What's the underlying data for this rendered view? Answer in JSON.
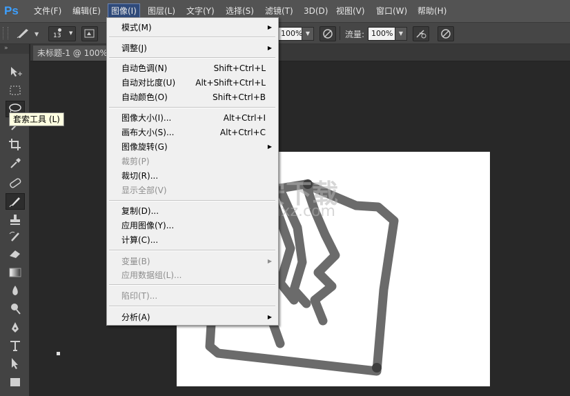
{
  "app": {
    "logo": "Ps"
  },
  "menubar": {
    "items": [
      "文件(F)",
      "编辑(E)",
      "图像(I)",
      "图层(L)",
      "文字(Y)",
      "选择(S)",
      "滤镜(T)",
      "3D(D)",
      "视图(V)",
      "窗口(W)",
      "帮助(H)"
    ],
    "active": "图像(I)"
  },
  "options_bar": {
    "brush_size": "13",
    "opacity_value": "100%",
    "flow_label": "流量:",
    "flow_value": "100%"
  },
  "document": {
    "tab_title": "未标题-1 @ 100%"
  },
  "toolbar": {
    "tooltip": "套索工具 (L)",
    "tools": [
      "move-tool",
      "marquee-tool",
      "lasso-tool",
      "quick-select-tool",
      "crop-tool",
      "eyedropper-tool",
      "healing-brush-tool",
      "brush-tool",
      "clone-stamp-tool",
      "history-brush-tool",
      "eraser-tool",
      "gradient-tool",
      "blur-tool",
      "dodge-tool",
      "pen-tool",
      "type-tool",
      "path-select-tool",
      "shape-tool"
    ]
  },
  "image_menu": {
    "mode": "模式(M)",
    "adjust": "调整(J)",
    "auto_tone": "自动色调(N)",
    "auto_tone_sc": "Shift+Ctrl+L",
    "auto_contrast": "自动对比度(U)",
    "auto_contrast_sc": "Alt+Shift+Ctrl+L",
    "auto_color": "自动颜色(O)",
    "auto_color_sc": "Shift+Ctrl+B",
    "image_size": "图像大小(I)...",
    "image_size_sc": "Alt+Ctrl+I",
    "canvas_size": "画布大小(S)...",
    "canvas_size_sc": "Alt+Ctrl+C",
    "rotation": "图像旋转(G)",
    "crop": "裁剪(P)",
    "trim": "裁切(R)...",
    "reveal_all": "显示全部(V)",
    "duplicate": "复制(D)...",
    "apply_image": "应用图像(Y)...",
    "calculations": "计算(C)...",
    "variables": "变量(B)",
    "apply_data_set": "应用数据组(L)...",
    "trap": "陷印(T)...",
    "analysis": "分析(A)"
  },
  "watermark": {
    "text_big": "安下载",
    "text_url": "anxz.com"
  },
  "colors": {
    "menu_bg": "#f0f0f0",
    "accent": "#3da0ff",
    "canvas": "#ffffff",
    "stroke": "#6b6b6b"
  }
}
